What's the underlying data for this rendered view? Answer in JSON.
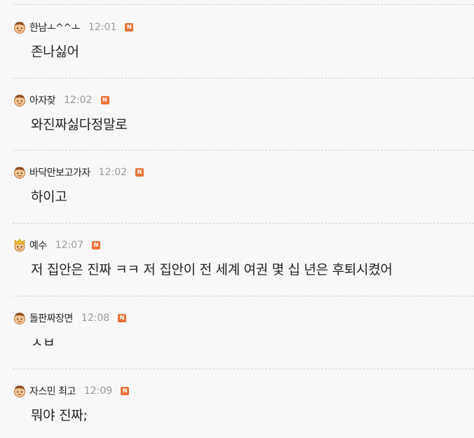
{
  "comments": [
    {
      "nickname": "한남ㅗ^^ㅗ",
      "time": "12:01",
      "badge": "N",
      "avatar": "boy-face-icon",
      "text": "존나싫어"
    },
    {
      "nickname": "아자잦",
      "time": "12:02",
      "badge": "N",
      "avatar": "boy-face-icon",
      "text": "와진짜싫다정말로"
    },
    {
      "nickname": "바닥만보고가자",
      "time": "12:02",
      "badge": "N",
      "avatar": "boy-face-icon",
      "text": "하이고"
    },
    {
      "nickname": "예수",
      "time": "12:07",
      "badge": "N",
      "avatar": "crown-face-icon",
      "text": "저 집안은 진짜 ㅋㅋ 저 집안이 전 세계 여권 몇 십 년은 후퇴시켰어"
    },
    {
      "nickname": "돌판짜장면",
      "time": "12:08",
      "badge": "N",
      "avatar": "boy-face-icon",
      "text": "ㅅㅂ"
    },
    {
      "nickname": "자스민 최고",
      "time": "12:09",
      "badge": "N",
      "avatar": "boy-face-icon",
      "text": "뭐야 진짜;"
    }
  ],
  "colors": {
    "background": "#f8f8f8",
    "badge": "#e9733a",
    "time": "#9a9a9a",
    "divider": "#cfcfcf"
  }
}
